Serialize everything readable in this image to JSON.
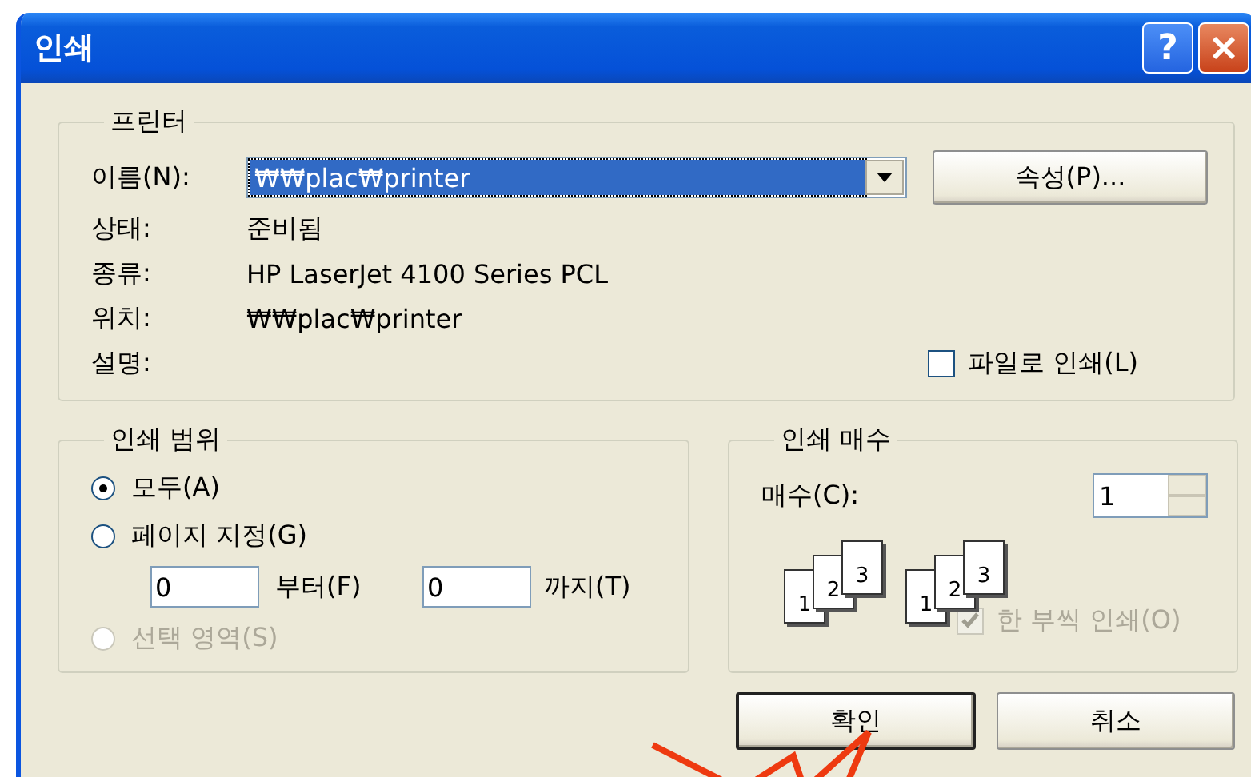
{
  "window": {
    "title": "인쇄",
    "help_button": "?"
  },
  "printer": {
    "legend": "프린터",
    "name_label": "이름(N):",
    "name_value": "₩₩plac₩printer",
    "properties_button": "속성(P)...",
    "details": [
      {
        "label": "상태:",
        "value": "준비됨"
      },
      {
        "label": "종류:",
        "value": "HP LaserJet 4100 Series PCL"
      },
      {
        "label": "위치:",
        "value": "₩₩plac₩printer"
      },
      {
        "label": "설명:"
      }
    ],
    "print_to_file": {
      "label": "파일로 인쇄(L)",
      "checked": false
    }
  },
  "print_range": {
    "legend": "인쇄 범위",
    "options": [
      {
        "label": "모두(A)",
        "selected": true,
        "disabled": false
      },
      {
        "label": "페이지 지정(G)",
        "selected": false,
        "disabled": false,
        "range": {
          "from_value": "0",
          "from_label": "부터(F)",
          "to_value": "0",
          "to_label": "까지(T)"
        }
      },
      {
        "label": "선택 영역(S)",
        "selected": false,
        "disabled": true
      }
    ]
  },
  "copies": {
    "legend": "인쇄 매수",
    "count_label": "매수(C):",
    "count_value": "1",
    "collate_icons": [
      {
        "pages": [
          "1",
          "2",
          "3"
        ]
      },
      {
        "pages": [
          "1",
          "2",
          "3"
        ]
      }
    ],
    "collate": {
      "label": "한 부씩 인쇄(O)",
      "checked": true,
      "disabled": true
    }
  },
  "buttons": [
    {
      "label": "확인",
      "default": true
    },
    {
      "label": "취소",
      "default": false
    }
  ]
}
